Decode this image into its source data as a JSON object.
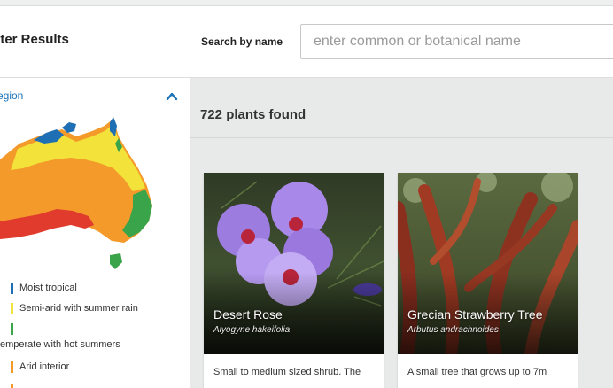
{
  "sidebar": {
    "title": "ilter Results",
    "region_label": "region",
    "legend": [
      {
        "label": "Moist tropical",
        "color": "#1f6fb5"
      },
      {
        "label": "Semi-arid with summer rain",
        "color": "#f2e23a"
      },
      {
        "label": "",
        "color": "#3aa44a"
      },
      {
        "label": "emperate with hot summers",
        "color": "#ffffff"
      },
      {
        "label": "Arid interior",
        "color": "#f39a2b"
      },
      {
        "label": "",
        "color": "#f39a2b"
      }
    ],
    "map_colors": {
      "tropical": "#1f6fb5",
      "semi_arid": "#f2e23a",
      "temperate": "#3aa44a",
      "arid": "#f39a2b",
      "south": "#e03b2c"
    }
  },
  "search": {
    "label": "Search by name",
    "placeholder": "enter common or botanical name"
  },
  "results": {
    "count_text": "722 plants found",
    "cards": [
      {
        "name": "Desert Rose",
        "botanical": "Alyogyne hakeifolia",
        "description": "Small to medium sized shrub. The"
      },
      {
        "name": "Grecian Strawberry Tree",
        "botanical": "Arbutus andrachnoides",
        "description": "A small tree that grows up to 7m"
      }
    ]
  }
}
